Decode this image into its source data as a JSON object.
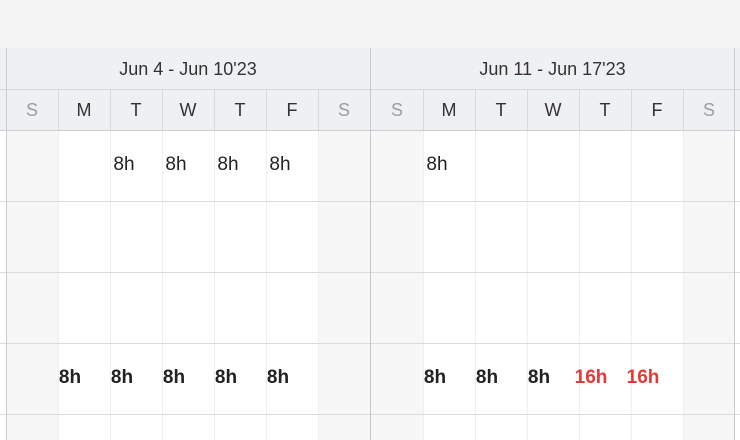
{
  "weeks": [
    {
      "label": "Jun 4 - Jun 10'23",
      "days": [
        "S",
        "M",
        "T",
        "W",
        "T",
        "F",
        "S"
      ],
      "rows": [
        [
          "",
          "",
          "8h",
          "8h",
          "8h",
          "8h",
          ""
        ],
        [
          "",
          "",
          "",
          "",
          "",
          "",
          ""
        ],
        [
          "",
          "",
          "",
          "",
          "",
          "",
          ""
        ],
        [
          "",
          "8h",
          "8h",
          "8h",
          "8h",
          "8h",
          ""
        ]
      ]
    },
    {
      "label": "Jun 11 - Jun 17'23",
      "days": [
        "S",
        "M",
        "T",
        "W",
        "T",
        "F",
        "S"
      ],
      "rows": [
        [
          "",
          "8h",
          "",
          "",
          "",
          "",
          ""
        ],
        [
          "",
          "",
          "",
          "",
          "",
          "",
          ""
        ],
        [
          "",
          "",
          "",
          "",
          "",
          "",
          ""
        ],
        [
          "",
          "8h",
          "8h",
          "8h",
          "16h",
          "16h",
          ""
        ]
      ]
    }
  ],
  "bold_rows": [
    3
  ],
  "overallocated_color": "#e53935"
}
